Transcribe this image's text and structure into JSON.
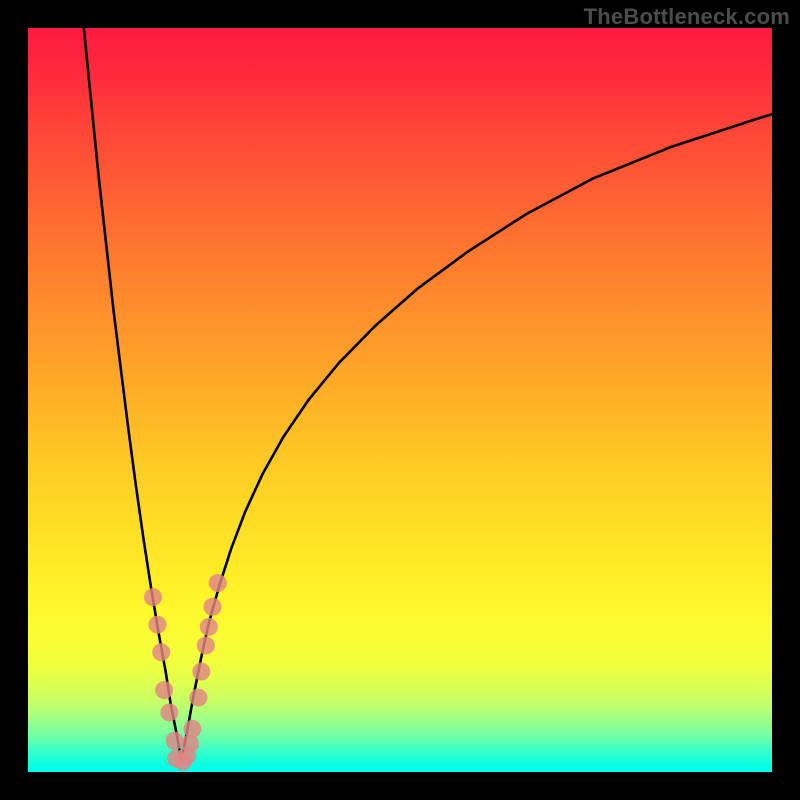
{
  "watermark": "TheBottleneck.com",
  "colors": {
    "frame": "#000000",
    "curve": "#000000",
    "marker_fill": "#e08585",
    "marker_stroke": "#7a2f2f"
  },
  "chart_data": {
    "type": "line",
    "title": "",
    "xlabel": "",
    "ylabel": "",
    "xlim": [
      0,
      100
    ],
    "ylim": [
      0,
      100
    ],
    "background_gradient": {
      "top_color": "#ff193f",
      "bottom_color": "#00fff0",
      "meaning": "red=high bottleneck, green=low bottleneck"
    },
    "series": [
      {
        "name": "bottleneck_curve_left",
        "x": [
          7.5,
          8.5,
          9.5,
          10.5,
          11.5,
          12.5,
          13.5,
          14.5,
          15.5,
          16.5,
          17.5,
          18.5,
          19.2,
          20.0,
          20.6
        ],
        "values": [
          100,
          90,
          80,
          71,
          62,
          54,
          46,
          38.5,
          31.5,
          25,
          19,
          13.5,
          9,
          5,
          1.5
        ]
      },
      {
        "name": "bottleneck_curve_right",
        "x": [
          20.6,
          21.3,
          22.2,
          23.2,
          24.3,
          25.7,
          27.3,
          29.2,
          31.5,
          34.3,
          37.7,
          41.8,
          46.7,
          52.4,
          59.2,
          67.0,
          76.0,
          86.4,
          98.0,
          100.0
        ],
        "values": [
          1.5,
          5,
          10,
          15,
          20,
          25,
          30,
          35,
          40,
          45,
          50,
          55,
          60,
          65,
          70,
          75,
          79.8,
          84.0,
          87.8,
          88.4
        ]
      }
    ],
    "markers": {
      "name": "sample_points",
      "description": "scatter markers clustered near curve minimum",
      "points": [
        {
          "x": 16.8,
          "y": 23.5
        },
        {
          "x": 17.4,
          "y": 19.8
        },
        {
          "x": 17.9,
          "y": 16.1
        },
        {
          "x": 18.3,
          "y": 11.0
        },
        {
          "x": 19.0,
          "y": 8.0
        },
        {
          "x": 19.7,
          "y": 4.2
        },
        {
          "x": 19.9,
          "y": 1.8
        },
        {
          "x": 20.8,
          "y": 1.4
        },
        {
          "x": 21.4,
          "y": 2.2
        },
        {
          "x": 21.8,
          "y": 3.8
        },
        {
          "x": 22.1,
          "y": 5.8
        },
        {
          "x": 22.9,
          "y": 10.0
        },
        {
          "x": 23.3,
          "y": 13.5
        },
        {
          "x": 23.9,
          "y": 17.0
        },
        {
          "x": 24.3,
          "y": 19.5
        },
        {
          "x": 24.8,
          "y": 22.2
        },
        {
          "x": 25.5,
          "y": 25.4
        }
      ]
    }
  }
}
